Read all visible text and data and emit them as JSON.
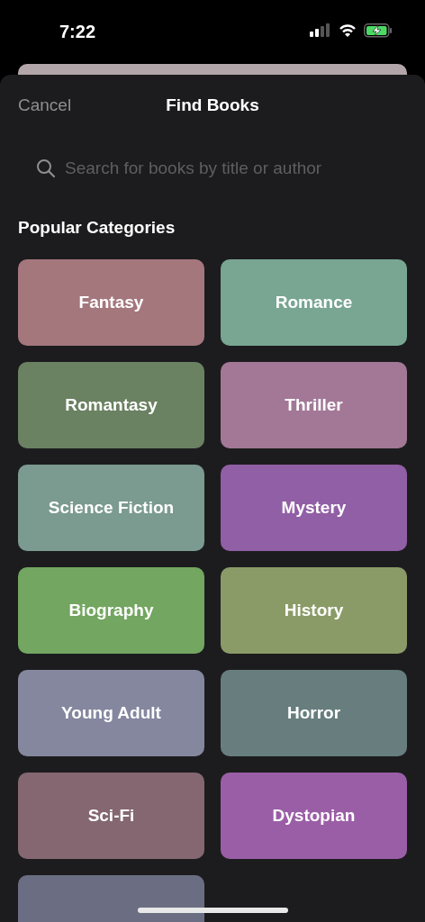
{
  "status_bar": {
    "time": "7:22"
  },
  "header": {
    "cancel": "Cancel",
    "title": "Find Books"
  },
  "search": {
    "placeholder": "Search for books by title or author"
  },
  "section_title": "Popular Categories",
  "categories": [
    {
      "label": "Fantasy",
      "color": "#a4777d"
    },
    {
      "label": "Romance",
      "color": "#78a692"
    },
    {
      "label": "Romantasy",
      "color": "#6a8162"
    },
    {
      "label": "Thriller",
      "color": "#a27896"
    },
    {
      "label": "Science Fiction",
      "color": "#7b9a90"
    },
    {
      "label": "Mystery",
      "color": "#915fa5"
    },
    {
      "label": "Biography",
      "color": "#73a660"
    },
    {
      "label": "History",
      "color": "#8b9b67"
    },
    {
      "label": "Young Adult",
      "color": "#84879e"
    },
    {
      "label": "Horror",
      "color": "#687e7e"
    },
    {
      "label": "Sci-Fi",
      "color": "#846770"
    },
    {
      "label": "Dystopian",
      "color": "#9a5ea6"
    },
    {
      "color": "#6b6e82"
    }
  ]
}
